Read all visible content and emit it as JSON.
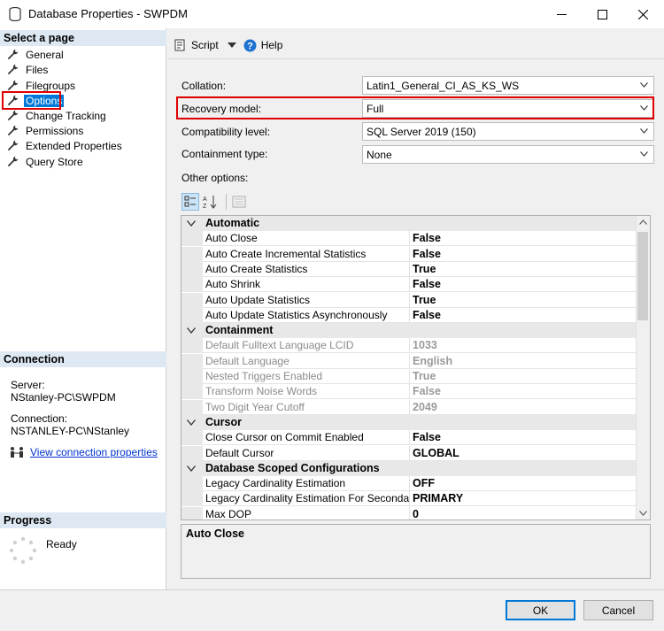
{
  "window": {
    "title": "Database Properties - SWPDM",
    "controls": {
      "minimize": "minimize-icon",
      "maximize": "maximize-icon",
      "close": "close-icon"
    }
  },
  "left_panel": {
    "select_page_header": "Select a page",
    "pages": [
      {
        "label": "General",
        "selected": false
      },
      {
        "label": "Files",
        "selected": false
      },
      {
        "label": "Filegroups",
        "selected": false
      },
      {
        "label": "Options",
        "selected": true
      },
      {
        "label": "Change Tracking",
        "selected": false
      },
      {
        "label": "Permissions",
        "selected": false
      },
      {
        "label": "Extended Properties",
        "selected": false
      },
      {
        "label": "Query Store",
        "selected": false
      }
    ],
    "connection_header": "Connection",
    "server_label": "Server:",
    "server_value": "NStanley-PC\\SWPDM",
    "connection_label": "Connection:",
    "connection_value": "NSTANLEY-PC\\NStanley",
    "view_connection_link": "View connection properties",
    "progress_header": "Progress",
    "progress_status": "Ready"
  },
  "toolbar": {
    "script_label": "Script",
    "help_label": "Help"
  },
  "properties": {
    "collation_label": "Collation:",
    "collation_value": "Latin1_General_CI_AS_KS_WS",
    "recovery_model_label": "Recovery model:",
    "recovery_model_value": "Full",
    "compatibility_label": "Compatibility level:",
    "compatibility_value": "SQL Server 2019 (150)",
    "containment_label": "Containment type:",
    "containment_value": "None",
    "other_options_label": "Other options:"
  },
  "grid": {
    "categories": [
      {
        "name": "Automatic",
        "rows": [
          {
            "name": "Auto Close",
            "value": "False",
            "disabled": false
          },
          {
            "name": "Auto Create Incremental Statistics",
            "value": "False",
            "disabled": false
          },
          {
            "name": "Auto Create Statistics",
            "value": "True",
            "disabled": false
          },
          {
            "name": "Auto Shrink",
            "value": "False",
            "disabled": false
          },
          {
            "name": "Auto Update Statistics",
            "value": "True",
            "disabled": false
          },
          {
            "name": "Auto Update Statistics Asynchronously",
            "value": "False",
            "disabled": false
          }
        ]
      },
      {
        "name": "Containment",
        "rows": [
          {
            "name": "Default Fulltext Language LCID",
            "value": "1033",
            "disabled": true
          },
          {
            "name": "Default Language",
            "value": "English",
            "disabled": true
          },
          {
            "name": "Nested Triggers Enabled",
            "value": "True",
            "disabled": true
          },
          {
            "name": "Transform Noise Words",
            "value": "False",
            "disabled": true
          },
          {
            "name": "Two Digit Year Cutoff",
            "value": "2049",
            "disabled": true
          }
        ]
      },
      {
        "name": "Cursor",
        "rows": [
          {
            "name": "Close Cursor on Commit Enabled",
            "value": "False",
            "disabled": false
          },
          {
            "name": "Default Cursor",
            "value": "GLOBAL",
            "disabled": false
          }
        ]
      },
      {
        "name": "Database Scoped Configurations",
        "rows": [
          {
            "name": "Legacy Cardinality Estimation",
            "value": "OFF",
            "disabled": false
          },
          {
            "name": "Legacy Cardinality Estimation For Secondary",
            "value": "PRIMARY",
            "disabled": false
          },
          {
            "name": "Max DOP",
            "value": "0",
            "disabled": false
          }
        ]
      }
    ]
  },
  "description": {
    "title": "Auto Close"
  },
  "buttons": {
    "ok_label": "OK",
    "cancel_label": "Cancel"
  },
  "colors": {
    "highlight_red": "#e00000",
    "selection_blue": "#0078d7",
    "section_header_bg": "#dde8f3"
  }
}
